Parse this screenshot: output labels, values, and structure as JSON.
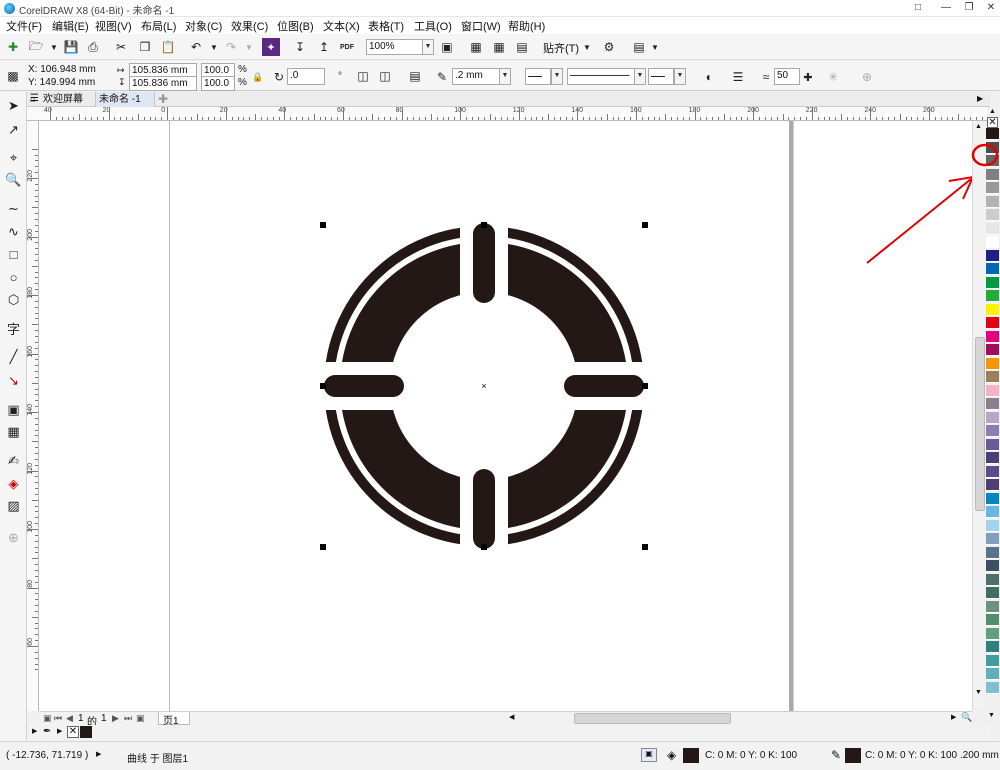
{
  "window": {
    "title": "CorelDRAW X8 (64-Bit) - 未命名 -1"
  },
  "menu": [
    "文件(F)",
    "编辑(E)",
    "视图(V)",
    "布局(L)",
    "对象(C)",
    "效果(C)",
    "位图(B)",
    "文本(X)",
    "表格(T)",
    "工具(O)",
    "窗口(W)",
    "帮助(H)"
  ],
  "toolbar": {
    "zoom": "100%",
    "snap_label": "贴齐(T)",
    "pdf_label": "PDF"
  },
  "properties": {
    "x": "X: 106.948 mm",
    "y": "Y: 149.994 mm",
    "width": "105.836 mm",
    "height": "105.836 mm",
    "scale_w": "100.0",
    "scale_h": "100.0",
    "percent": "%",
    "rotation": ".0",
    "outline_width": ".2 mm",
    "smooth": "50"
  },
  "tabs": {
    "welcome": "欢迎屏幕",
    "document": "未命名 -1"
  },
  "ruler": {
    "h_ticks": [
      "40",
      "20",
      "0",
      "20",
      "40",
      "60",
      "80",
      "100",
      "120",
      "140",
      "160",
      "180",
      "200",
      "220",
      "240",
      "260"
    ],
    "v_ticks": [
      "220",
      "200",
      "180",
      "160",
      "140",
      "120",
      "100",
      "80",
      "60"
    ]
  },
  "pages": {
    "current": "1",
    "of": "的",
    "total": "1",
    "page_tab": "页1"
  },
  "status": {
    "coords": "( -12.736, 71.719 )",
    "object_info": "曲线 于 图层1",
    "fill_info": "C: 0 M: 0 Y: 0 K: 100",
    "outline_info": "C: 0 M: 0 Y: 0 K: 100 .200 mm"
  },
  "colors": {
    "shape_fill": "#231815",
    "annotation": "#e00000",
    "palette": [
      "#231815",
      "#4d4d4d",
      "#666666",
      "#808080",
      "#999999",
      "#b3b3b3",
      "#cccccc",
      "#e6e6e6",
      "#ffffff",
      "#1d2088",
      "#0068b7",
      "#009944",
      "#22ac38",
      "#fff100",
      "#e60012",
      "#e4007f",
      "#a40b5d",
      "#f39800",
      "#9e7e5b",
      "#f4b3c2",
      "#8c7f8c",
      "#b7a6c9",
      "#8b7db8",
      "#6a5a9c",
      "#4a3f7a",
      "#5b4b8a",
      "#4f3f73",
      "#0088c6",
      "#65b8e6",
      "#a2d4f0",
      "#7f9fbf",
      "#56738f",
      "#3e5064",
      "#4f6e6e",
      "#3f6f5f",
      "#6f8f7f",
      "#4f8f6f",
      "#5fa07f",
      "#2f7f7f",
      "#3f9f9f",
      "#5fafbf",
      "#7fbfcf"
    ]
  }
}
